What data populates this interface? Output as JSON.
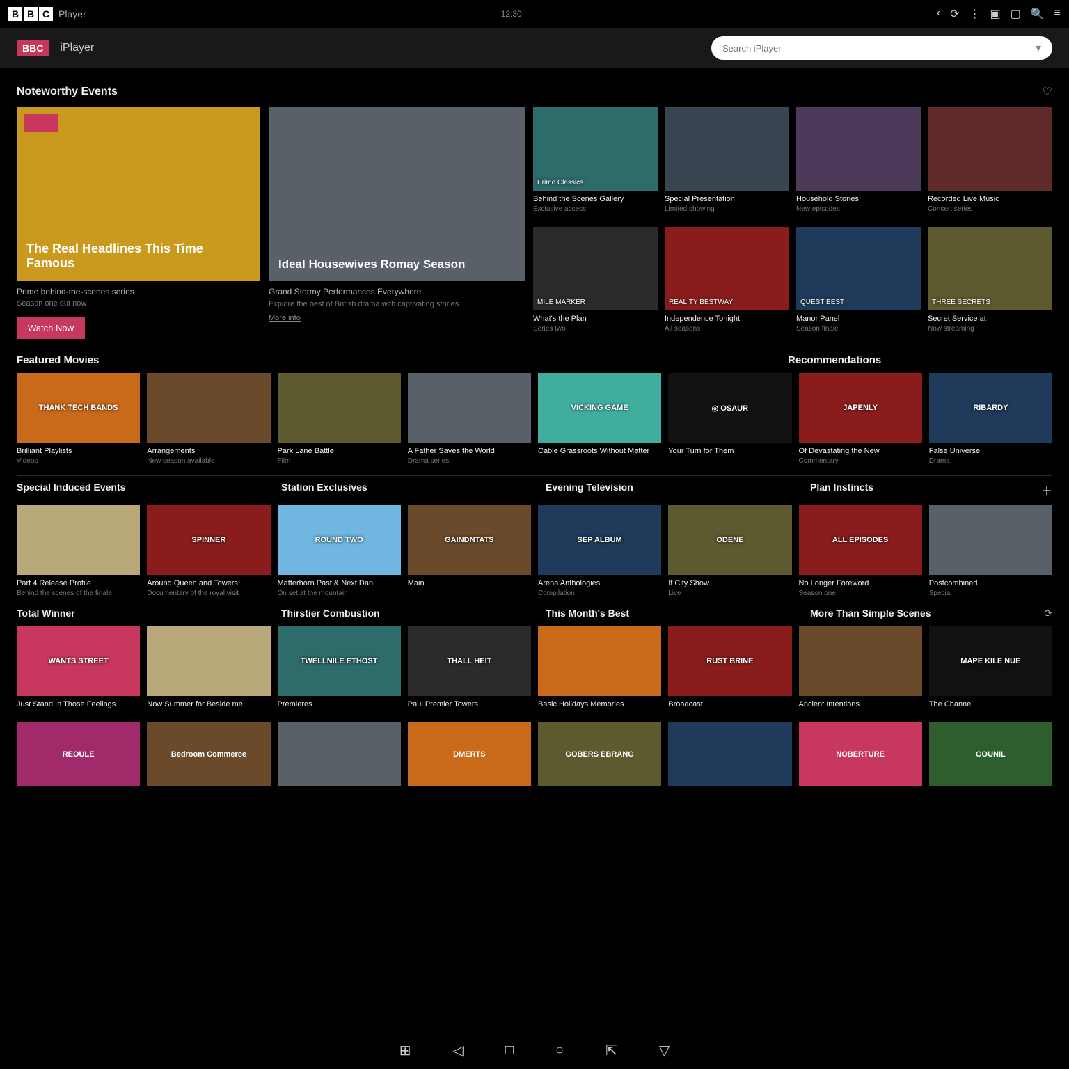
{
  "top": {
    "logo_letters": [
      "B",
      "B",
      "C"
    ],
    "logo_word": "Player",
    "center_text": "12:30",
    "search_placeholder": "Search iPlayer"
  },
  "sub": {
    "badge": "BBC",
    "brand": "iPlayer"
  },
  "sections": {
    "featured_title": "Noteworthy Events",
    "row1_left": "Featured Movies",
    "row1_right": "Recommendations",
    "hero1": {
      "title": "The Real Headlines This Time Famous",
      "sub1": "Prime behind-the-scenes series",
      "sub2": "Season one out now",
      "cta": "Watch Now"
    },
    "hero2": {
      "title": "Ideal Housewives Romay Season",
      "sub1": "Grand Stormy Performances Everywhere",
      "sub2": "Explore the best of British drama with captivating stories",
      "more": "More info"
    },
    "small_cards": [
      {
        "overlay": "Prime Classics",
        "title": "Behind the Scenes Gallery",
        "desc": "Exclusive access",
        "color": "c-teal"
      },
      {
        "overlay": "",
        "title": "Special Presentation",
        "desc": "Limited showing",
        "color": "c-slate"
      },
      {
        "overlay": "",
        "title": "Household Stories",
        "desc": "New episodes",
        "color": "c-purple"
      },
      {
        "overlay": "",
        "title": "Recorded Live Music",
        "desc": "Concert series",
        "color": "c-maroon"
      },
      {
        "overlay": "MILE MARKER",
        "title": "What's the Plan",
        "desc": "Series two",
        "color": "c-charcoal"
      },
      {
        "overlay": "REALITY BESTWAY",
        "title": "Independence Tonight",
        "desc": "All seasons",
        "color": "c-red"
      },
      {
        "overlay": "QUEST BEST",
        "title": "Manor Panel",
        "desc": "Season finale",
        "color": "c-navy"
      },
      {
        "overlay": "THREE SECRETS",
        "title": "Secret Service at",
        "desc": "Now streaming",
        "color": "c-olive"
      }
    ],
    "row1": [
      {
        "overlay": "THANK TECH BANDS",
        "title": "Brilliant Playlists",
        "desc": "Videos",
        "color": "c-orange"
      },
      {
        "overlay": "",
        "title": "Arrangements",
        "desc": "New season available",
        "color": "c-brown"
      },
      {
        "overlay": "",
        "title": "Park Lane Battle",
        "desc": "Film",
        "color": "c-olive"
      },
      {
        "overlay": "",
        "title": "A Father Saves the World",
        "desc": "Drama series",
        "color": "c-grey"
      },
      {
        "overlay": "VICKING GAME",
        "title": "Cable Grassroots Without Matter",
        "desc": "",
        "color": "c-mint"
      },
      {
        "overlay": "◎ OSAUR",
        "title": "Your Turn for Them",
        "desc": "",
        "color": "c-black"
      },
      {
        "overlay": "JAPENLY",
        "title": "Of Devastating the New",
        "desc": "Commentary",
        "color": "c-red"
      },
      {
        "overlay": "RIBARDY",
        "title": "False Universe",
        "desc": "Drama",
        "color": "c-navy"
      }
    ],
    "block2_h1": "Special Induced Events",
    "block2_h2": "Station Exclusives",
    "block2_h3": "Evening Television",
    "block2_h4": "Plan Instincts",
    "row2": [
      {
        "overlay": "",
        "title": "Part 4 Release Profile",
        "desc": "Behind the scenes of the finale",
        "color": "c-cream"
      },
      {
        "overlay": "SPINNER",
        "title": "Around Queen and Towers",
        "desc": "Documentary of the royal visit",
        "color": "c-red"
      },
      {
        "overlay": "ROUND TWO",
        "title": "Matterhorn Past & Next Dan",
        "desc": "On set at the mountain",
        "color": "c-sky"
      },
      {
        "overlay": "GAINDNTATS",
        "title": "Main",
        "desc": "",
        "color": "c-brown"
      },
      {
        "overlay": "SEP ALBUM",
        "title": "Arena Anthologies",
        "desc": "Compilation",
        "color": "c-navy"
      },
      {
        "overlay": "ODENE",
        "title": "If City Show",
        "desc": "Live",
        "color": "c-olive"
      },
      {
        "overlay": "ALL EPISODES",
        "title": "No Longer Foreword",
        "desc": "Season one",
        "color": "c-red"
      },
      {
        "overlay": "",
        "title": "Postcombined",
        "desc": "Special",
        "color": "c-grey"
      }
    ],
    "block3_h1": "Total Winner",
    "block3_h2": "Thirstier Combustion",
    "block3_h3": "This Month's Best",
    "block3_h4": "More Than Simple Scenes",
    "row3": [
      {
        "overlay": "WANTS STREET",
        "title": "Just Stand In Those Feelings",
        "desc": "",
        "color": "c-pink"
      },
      {
        "overlay": "",
        "title": "Now Summer for Beside me",
        "desc": "",
        "color": "c-cream"
      },
      {
        "overlay": "TWELLNILE ETHOST",
        "title": "Premieres",
        "desc": "",
        "color": "c-teal"
      },
      {
        "overlay": "THALL HEIT",
        "title": "Paul Premier Towers",
        "desc": "",
        "color": "c-charcoal"
      },
      {
        "overlay": "",
        "title": "Basic Holidays Memories",
        "desc": "",
        "color": "c-orange"
      },
      {
        "overlay": "RUST BRINE",
        "title": "Broadcast",
        "desc": "",
        "color": "c-red"
      },
      {
        "overlay": "",
        "title": "Ancient Intentions",
        "desc": "",
        "color": "c-brown"
      },
      {
        "overlay": "MAPE KILE NUE",
        "title": "The Channel",
        "desc": "",
        "color": "c-black"
      }
    ],
    "row4": [
      {
        "overlay": "REOULE",
        "color": "c-magenta"
      },
      {
        "overlay": "Bedroom Commerce",
        "color": "c-brown"
      },
      {
        "overlay": "",
        "color": "c-grey"
      },
      {
        "overlay": "DMERTS",
        "color": "c-orange"
      },
      {
        "overlay": "GOBERS EBRANG",
        "color": "c-olive"
      },
      {
        "overlay": "",
        "color": "c-navy"
      },
      {
        "overlay": "NOBERTURE",
        "color": "c-pink"
      },
      {
        "overlay": "GOUNIL",
        "color": "c-green"
      }
    ]
  }
}
